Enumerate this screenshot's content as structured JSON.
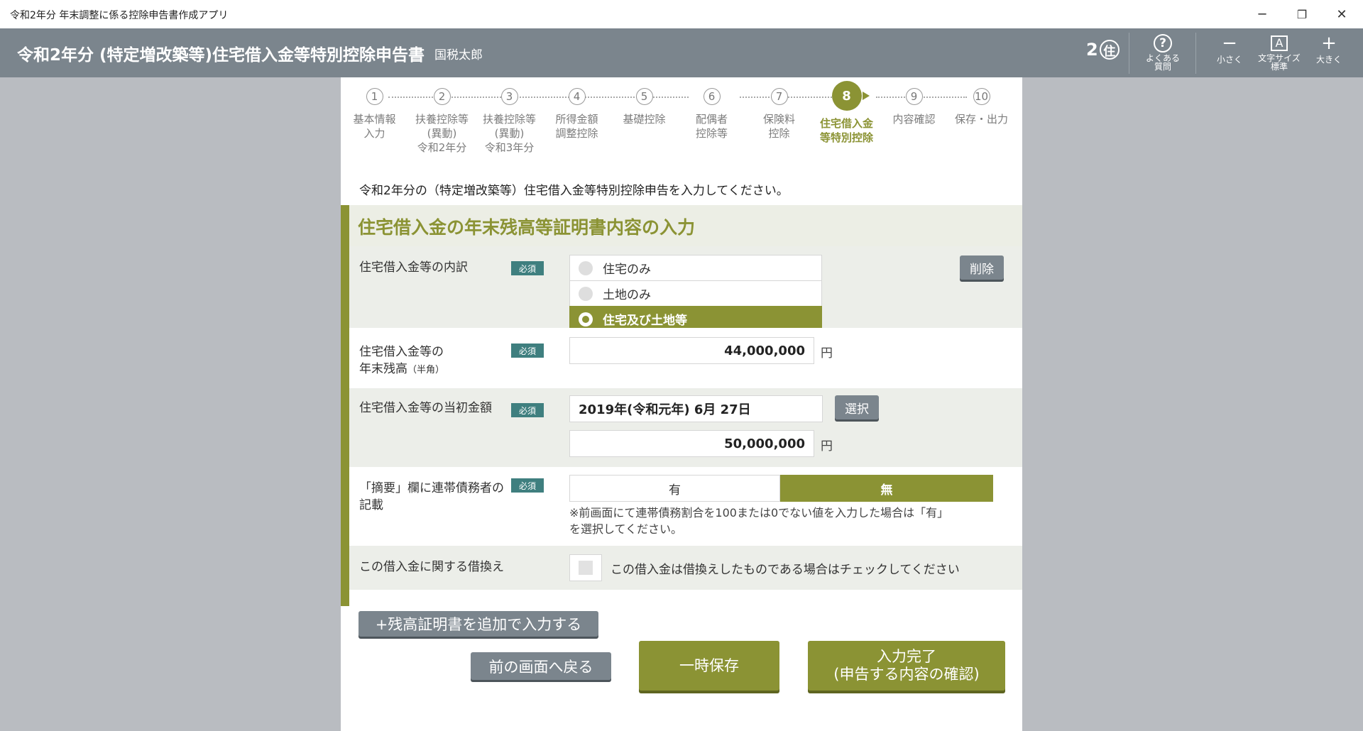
{
  "window": {
    "title": "令和2年分 年末調整に係る控除申告書作成アプリ",
    "controls": {
      "minimize": "─",
      "restore": "❐",
      "close": "✕"
    }
  },
  "header": {
    "title": "令和2年分 (特定増改築等)住宅借入金等特別控除申告書",
    "user": "国税太郎",
    "badge_num": "2",
    "badge_char": "住",
    "faq": {
      "icon": "?",
      "label_line1": "よくある",
      "label_line2": "質問"
    },
    "smaller": {
      "icon": "−",
      "label": "小さく"
    },
    "font_size": {
      "icon": "A",
      "label_line1": "文字サイズ",
      "label_line2": "標準"
    },
    "larger": {
      "icon": "+",
      "label": "大きく"
    }
  },
  "steps": [
    {
      "num": "1",
      "label": "基本情報\n入力"
    },
    {
      "num": "2",
      "label": "扶養控除等\n(異動)\n令和2年分"
    },
    {
      "num": "3",
      "label": "扶養控除等\n(異動)\n令和3年分"
    },
    {
      "num": "4",
      "label": "所得金額\n調整控除"
    },
    {
      "num": "5",
      "label": "基礎控除"
    },
    {
      "num": "6",
      "label": "配偶者\n控除等"
    },
    {
      "num": "7",
      "label": "保険料\n控除"
    },
    {
      "num": "8",
      "label": "住宅借入金\n等特別控除"
    },
    {
      "num": "9",
      "label": "内容確認"
    },
    {
      "num": "10",
      "label": "保存・出力"
    }
  ],
  "instruction": "令和2年分の（特定増改築等）住宅借入金等特別控除申告を入力してください。",
  "section": {
    "title": "住宅借入金の年末残高等証明書内容の入力",
    "required_label": "必須",
    "breakdown": {
      "label": "住宅借入金等の内訳",
      "options": [
        "住宅のみ",
        "土地のみ",
        "住宅及び土地等"
      ],
      "selected_index": 2,
      "delete_label": "削除"
    },
    "balance": {
      "label_line1": "住宅借入金等の",
      "label_line2": "年末残高",
      "label_note": "（半角）",
      "value": "44,000,000",
      "unit": "円"
    },
    "initial": {
      "label": "住宅借入金等の当初金額",
      "date": "2019年(令和元年) 6月 27日",
      "select_label": "選択",
      "value": "50,000,000",
      "unit": "円"
    },
    "joint": {
      "label_line1": "「摘要」欄に連帯債務者の",
      "label_line2": "記載",
      "yes": "有",
      "no": "無",
      "selected": "無",
      "note_line1": "※前画面にて連帯債務割合を100または0でない値を入力した場合は「有」",
      "note_line2": "を選択してください。"
    },
    "refinance": {
      "label": "この借入金に関する借換え",
      "checked": false,
      "checkbox_label": "この借入金は借換えしたものである場合はチェックしてください"
    }
  },
  "buttons": {
    "add_certificate": "+残高証明書を追加で入力する",
    "back": "前の画面へ戻る",
    "temp_save": "一時保存",
    "complete_line1": "入力完了",
    "complete_line2": "(申告する内容の確認)"
  },
  "colors": {
    "accent": "#8b9334",
    "header": "#7b858d",
    "required": "#3f7f7f"
  }
}
